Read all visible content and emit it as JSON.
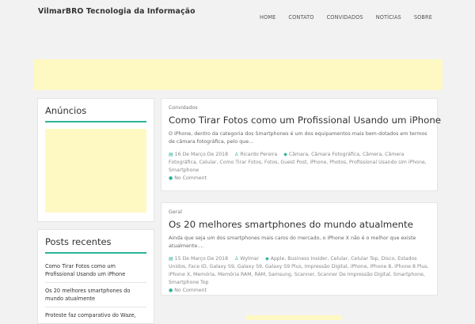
{
  "site": {
    "title": "VilmarBRO Tecnologia da Informação"
  },
  "nav": {
    "items": [
      "HOME",
      "CONTATO",
      "CONVIDADOS",
      "NOTÍCIAS",
      "SOBRE"
    ]
  },
  "sidebar": {
    "ads_title": "Anúncios",
    "recent_title": "Posts recentes",
    "recent_items": [
      "Como Tirar Fotos como um Profissional Usando um iPhone",
      "Os 20 melhores smartphones do mundo atualmente",
      "Proteste faz comparativo do Waze,"
    ]
  },
  "posts": [
    {
      "category": "Convidados",
      "title": "Como Tirar Fotos como um Profissional Usando um iPhone",
      "excerpt": "O iPhone, dentro da categoria dos Smartphones é um dos equipamentos mais bem-dotados em termos de câmara fotográfica, pelo que…",
      "date": "16 De Março De 2018",
      "author": "Ricardo Pereira",
      "tags": "Câmara, Câmara Fotográfica, Câmera, Câmera Fotográfica, Celular, Como Tirar Fotos, Fotos, Guest Post, iPhone, Photos, Profissional Usando Um iPhone, Smartphone",
      "comments": "No Comment"
    },
    {
      "category": "Geral",
      "title": "Os 20 melhores smartphones do mundo atualmente",
      "excerpt": "Ainda que seja um dos smartphones mais caros do mercado, o iPhone X não é o melhor que existe atualmente.…",
      "date": "15 De Março De 2018",
      "author": "Wylmar",
      "tags": "Apple, Business Insider, Celular, Celular Top, Disco, Estados Unidos, Face ID, Galaxy S9, Galaxy S9, Galaxy S9 Plus, Impressão Digital, iPhone, iPhone 8, iPhone 8 Plus, iPhone X, Memória, Memória RAM, RAM, Samsung, Scanner, Scanner De Impressão Digital, Smartphone, Smartphone Top",
      "comments": "No Comment"
    }
  ],
  "icons": {
    "date": "calendar-icon",
    "author": "user-icon",
    "tags": "tags-icon",
    "comments": "comment-icon"
  },
  "colors": {
    "accent": "#2cb39a",
    "ad_background": "#fef9c3",
    "page_background": "#f2f2f2"
  }
}
